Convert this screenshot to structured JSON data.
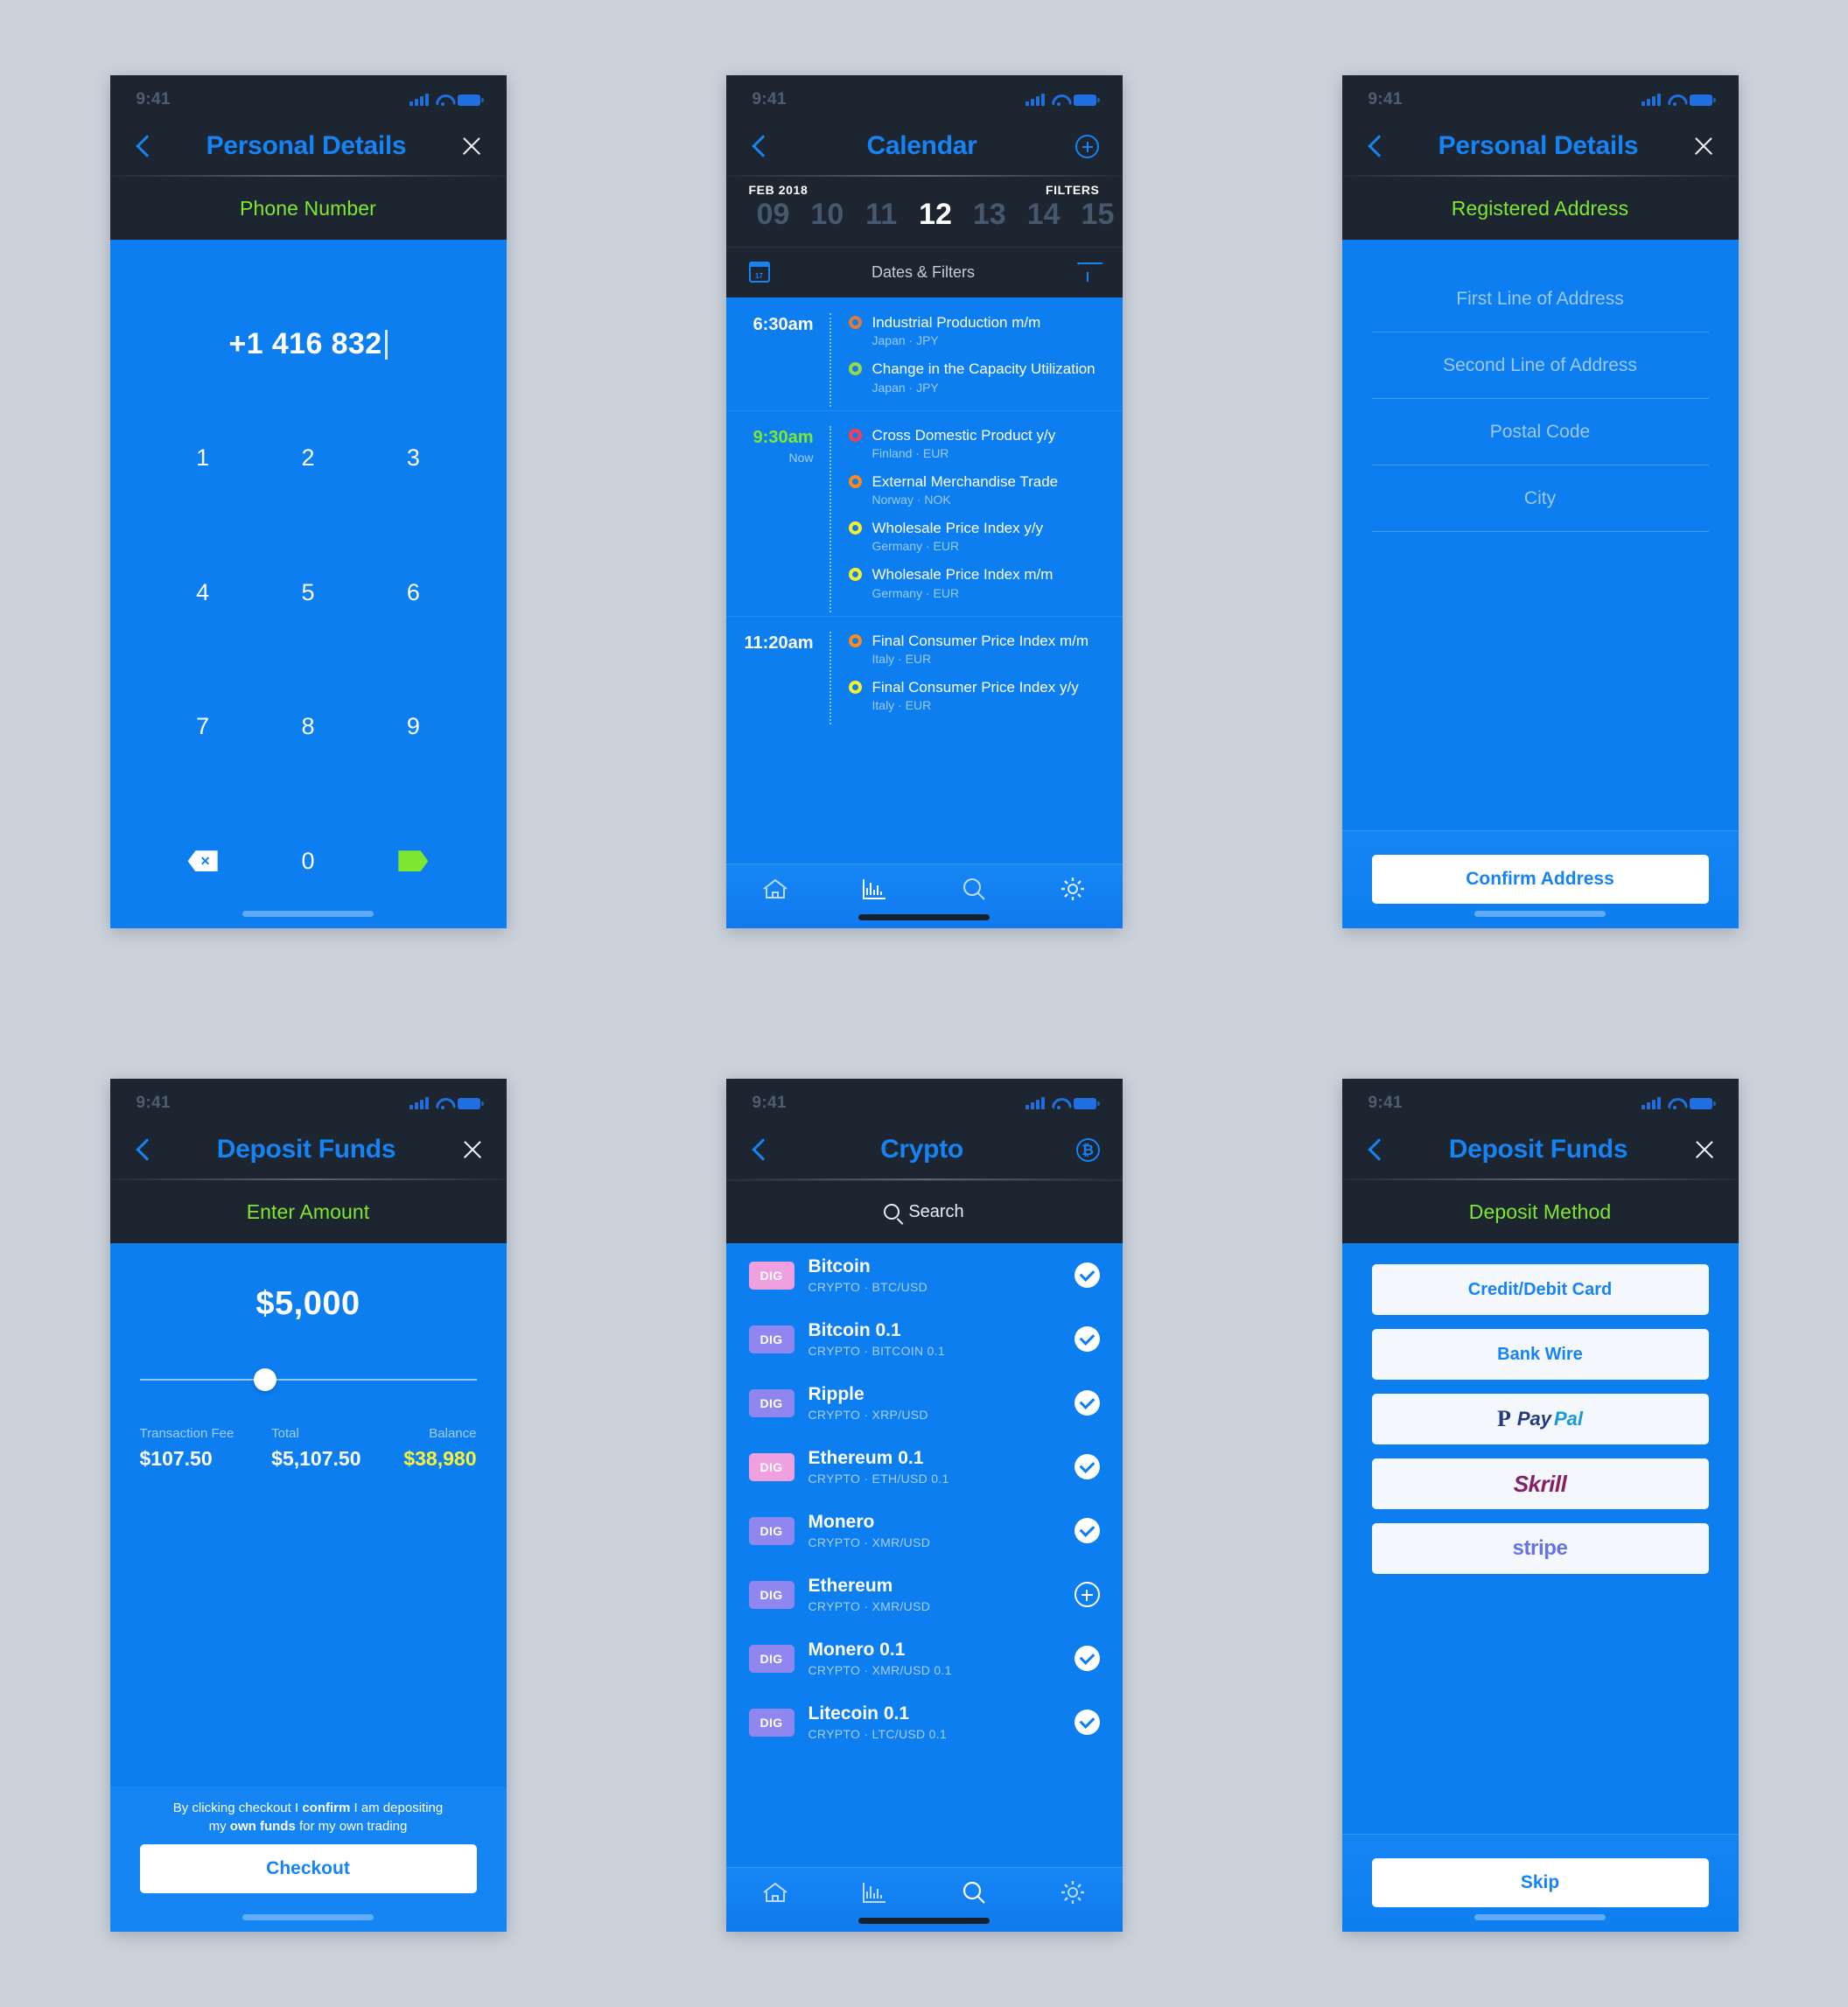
{
  "status_bar": {
    "time": "9:41"
  },
  "screens": {
    "phone_number": {
      "nav_title": "Personal Details",
      "section_label": "Phone Number",
      "value": "+1 416 832",
      "keys": [
        "1",
        "2",
        "3",
        "4",
        "5",
        "6",
        "7",
        "8",
        "9"
      ],
      "key_zero": "0",
      "key_delete": "delete-key",
      "key_submit": "submit-key"
    },
    "calendar": {
      "nav_title": "Calendar",
      "month_label": "FEB 2018",
      "filters_label": "FILTERS",
      "days": [
        "09",
        "10",
        "11",
        "12",
        "13",
        "14",
        "15"
      ],
      "active_day": "12",
      "filter_bar_label": "Dates & Filters",
      "groups": [
        {
          "time": "6:30am",
          "now": "",
          "events": [
            {
              "title": "Industrial Production m/m",
              "meta": "Japan  ·  JPY",
              "color": "#e07b39"
            },
            {
              "title": "Change in the Capacity Utilization",
              "meta": "Japan  ·  JPY",
              "color": "#9ad944"
            }
          ]
        },
        {
          "time": "9:30am",
          "now": "Now",
          "events": [
            {
              "title": "Cross Domestic Product y/y",
              "meta": "Finland  ·  EUR",
              "color": "#ff3b4e"
            },
            {
              "title": "External Merchandise Trade",
              "meta": "Norway  ·  NOK",
              "color": "#ff8a16"
            },
            {
              "title": "Wholesale Price Index y/y",
              "meta": "Germany  ·  EUR",
              "color": "#f7f02a"
            },
            {
              "title": "Wholesale Price Index m/m",
              "meta": "Germany  ·  EUR",
              "color": "#f7f02a"
            }
          ]
        },
        {
          "time": "11:20am",
          "now": "",
          "events": [
            {
              "title": "Final Consumer Price Index m/m",
              "meta": "Italy  ·  EUR",
              "color": "#ff8a16"
            },
            {
              "title": "Final Consumer Price Index y/y",
              "meta": "Italy  ·  EUR",
              "color": "#f7f02a"
            }
          ]
        }
      ],
      "tabs": [
        "home-icon",
        "chart-icon",
        "search-icon",
        "gear-icon"
      ],
      "active_tab": "chart-icon"
    },
    "registered_address": {
      "nav_title": "Personal Details",
      "section_label": "Registered Address",
      "fields": [
        "First Line of Address",
        "Second Line of Address",
        "Postal Code",
        "City"
      ],
      "cta": "Confirm Address"
    },
    "deposit_amount": {
      "nav_title": "Deposit Funds",
      "section_label": "Enter Amount",
      "amount": "$5,000",
      "slider_percent": 34,
      "stats": [
        {
          "label": "Transaction Fee",
          "value": "$107.50",
          "highlight": false
        },
        {
          "label": "Total",
          "value": "$5,107.50",
          "highlight": false
        },
        {
          "label": "Balance",
          "value": "$38,980",
          "highlight": true
        }
      ],
      "disclaimer_1a": "By clicking checkout I ",
      "disclaimer_1b": "confirm",
      "disclaimer_1c": " I am depositing",
      "disclaimer_2a": "my ",
      "disclaimer_2b": "own funds",
      "disclaimer_2c": " for my own trading",
      "cta": "Checkout"
    },
    "crypto": {
      "nav_title": "Crypto",
      "search_placeholder": "Search",
      "badge_text": "DIG",
      "rows": [
        {
          "name": "Bitcoin",
          "meta": "CRYPTO  ·  BTC/USD",
          "badge_color": "#f09fe0",
          "action": "check"
        },
        {
          "name": "Bitcoin 0.1",
          "meta": "CRYPTO  ·  BITCOIN 0.1",
          "badge_color": "#8f86ef",
          "action": "check"
        },
        {
          "name": "Ripple",
          "meta": "CRYPTO  ·  XRP/USD",
          "badge_color": "#8f86ef",
          "action": "check"
        },
        {
          "name": "Ethereum 0.1",
          "meta": "CRYPTO  ·  ETH/USD 0.1",
          "badge_color": "#f09fe0",
          "action": "check"
        },
        {
          "name": "Monero",
          "meta": "CRYPTO  ·  XMR/USD",
          "badge_color": "#8f86ef",
          "action": "check"
        },
        {
          "name": "Ethereum",
          "meta": "CRYPTO  ·  XMR/USD",
          "badge_color": "#8f86ef",
          "action": "plus"
        },
        {
          "name": "Monero 0.1",
          "meta": "CRYPTO  ·  XMR/USD 0.1",
          "badge_color": "#8f86ef",
          "action": "check"
        },
        {
          "name": "Litecoin 0.1",
          "meta": "CRYPTO  ·  LTC/USD 0.1",
          "badge_color": "#8f86ef",
          "action": "check"
        }
      ],
      "tabs": [
        "home-icon",
        "chart-icon",
        "search-icon",
        "gear-icon"
      ],
      "active_tab": "search-icon"
    },
    "deposit_method": {
      "nav_title": "Deposit Funds",
      "section_label": "Deposit Method",
      "methods": [
        {
          "type": "text",
          "label": "Credit/Debit Card"
        },
        {
          "type": "text",
          "label": "Bank Wire"
        },
        {
          "type": "paypal",
          "label": "PayPal",
          "part1": "Pay",
          "part2": "Pal",
          "mark": "P"
        },
        {
          "type": "skrill",
          "label": "Skrill"
        },
        {
          "type": "stripe",
          "label": "stripe"
        }
      ],
      "cta": "Skip"
    }
  },
  "colors": {
    "brand_blue": "#0d7ef0",
    "nav_blue": "#1683f5",
    "dark": "#1d2530",
    "green": "#7ee831",
    "yellow": "#f9f43a",
    "page_bg": "#ccd2db"
  }
}
